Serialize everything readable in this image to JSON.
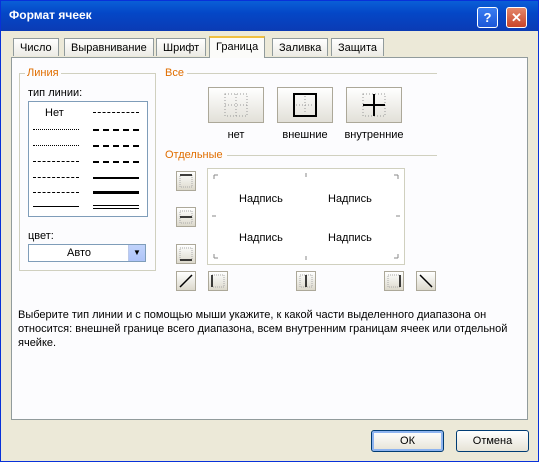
{
  "window": {
    "title": "Формат ячеек",
    "help_glyph": "?",
    "close_glyph": "✕"
  },
  "tabs": [
    {
      "label": "Число"
    },
    {
      "label": "Выравнивание"
    },
    {
      "label": "Шрифт"
    },
    {
      "label": "Граница",
      "active": true
    },
    {
      "label": "Заливка"
    },
    {
      "label": "Защита"
    }
  ],
  "line_group": {
    "title": "Линия",
    "style_label": "тип линии:",
    "none_label": "Нет",
    "color_label": "цвет:",
    "color_value": "Авто"
  },
  "presets_group": {
    "title": "Все",
    "none_label": "нет",
    "outline_label": "внешние",
    "inside_label": "внутренние"
  },
  "border_group": {
    "title": "Отдельные",
    "preview_text": [
      "Надпись",
      "Надпись",
      "Надпись",
      "Надпись"
    ]
  },
  "description": "Выберите тип линии и с помощью мыши укажите, к какой части выделенного диапазона он относится: внешней границе всего диапазона, всем внутренним границам ячеек или отдельной ячейке.",
  "buttons": {
    "ok": "ОК",
    "cancel": "Отмена"
  }
}
